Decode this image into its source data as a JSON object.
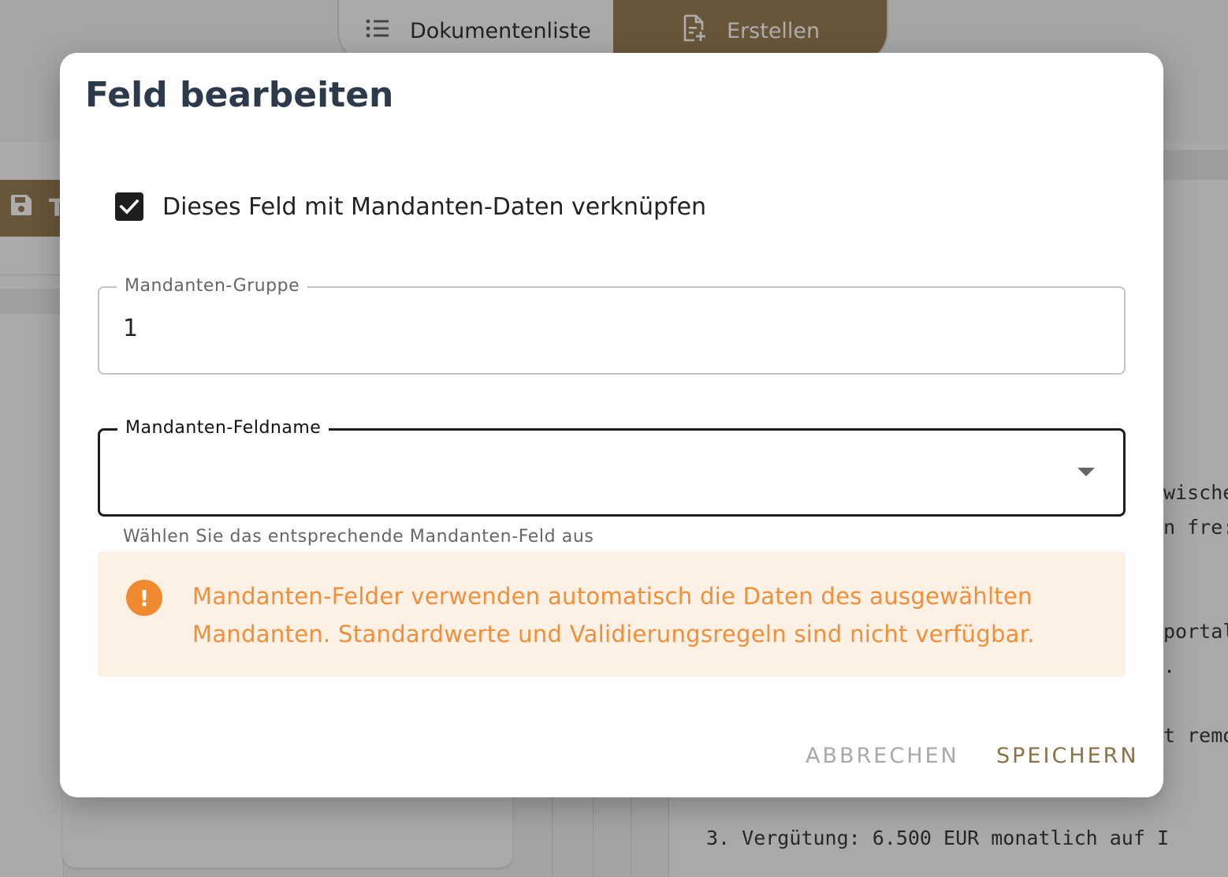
{
  "app": {
    "nav": {
      "document_list_label": "Dokumentenliste",
      "create_label": "Erstellen"
    },
    "toolbar": {
      "save_label_partial": "T"
    },
    "document_fragments": {
      "line1": "wische",
      "line2": "n fre:",
      "line3": "portal",
      "line4": ".",
      "line5": "t remo",
      "line6": "3. Vergütung: 6.500 EUR monatlich auf I"
    },
    "accent_color": "#9a7f53"
  },
  "dialog": {
    "title": "Feld bearbeiten",
    "link_checkbox": {
      "label": "Dieses Feld mit Mandanten-Daten verknüpfen",
      "checked": true
    },
    "group_field": {
      "label": "Mandanten-Gruppe",
      "value": "1"
    },
    "fieldname_field": {
      "label": "Mandanten-Feldname",
      "value": "",
      "helper": "Wählen Sie das entsprechende Mandanten-Feld aus"
    },
    "alert": {
      "icon": "exclamation-icon",
      "text": "Mandanten-Felder verwenden automatisch die Daten des ausgewählten Mandanten. Standardwerte und Validierungsregeln sind nicht verfügbar.",
      "color": "#ef8f3a"
    },
    "actions": {
      "cancel_label": "ABBRECHEN",
      "save_label": "SPEICHERN"
    }
  }
}
